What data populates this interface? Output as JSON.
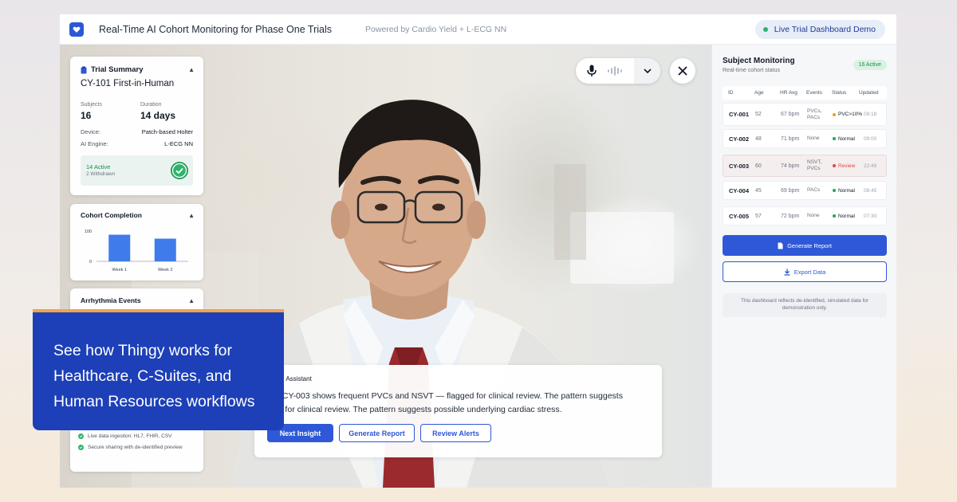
{
  "header": {
    "title": "Real-Time AI Cohort Monitoring for Phase One Trials",
    "powered_by": "Powered by Cardio Yield + L-ECG NN",
    "live_label": "Live Trial Dashboard Demo"
  },
  "trial_summary": {
    "heading": "Trial Summary",
    "trial_name": "CY-101 First-in-Human",
    "subjects_label": "Subjects",
    "subjects_value": "16",
    "duration_label": "Duration",
    "duration_value": "14 days",
    "device_label": "Device:",
    "device_value": "Patch-based Holter",
    "engine_label": "AI Engine:",
    "engine_value": "L-ECG NN",
    "active_text": "14 Active",
    "withdrawn_text": "2 Withdrawn"
  },
  "cohort_completion": {
    "heading": "Cohort Completion",
    "chart_data": {
      "type": "bar",
      "categories": [
        "Week 1",
        "Week 2"
      ],
      "values": [
        88,
        75
      ],
      "ylim": [
        0,
        100
      ],
      "ytick_labels": [
        "100",
        "0"
      ],
      "color": "#3f7bea"
    }
  },
  "arrhythmia_events": {
    "heading": "Arrhythmia Events"
  },
  "features": [
    "Live data ingestion: HL7, FHIR, CSV",
    "Secure sharing with de-identified preview"
  ],
  "promo": {
    "text": "See how Thingy works for\nHealthcare, C-Suites, and\nHuman Resources workflows"
  },
  "assistant": {
    "heading": "cal AI Assistant",
    "message": "ect CY-003 shows frequent PVCs and NSVT — flagged for clinical review. The pattern suggests\nged for clinical review. The pattern suggests possible underlying cardiac stress.",
    "buttons": [
      "Next Insight",
      "Generate Report",
      "Review Alerts"
    ]
  },
  "monitoring": {
    "title": "Subject Monitoring",
    "subtitle": "Real-time cohort status",
    "badge": "16 Active",
    "columns": [
      "ID",
      "Age",
      "HR Avg",
      "Events",
      "Status",
      "Updated"
    ],
    "rows": [
      {
        "id": "CY-001",
        "age": "52",
        "hr": "67 bpm",
        "events": "PVCs,\nPACs",
        "status": "PVC>10%",
        "status_color": "#f59e0b",
        "updated": "09:18"
      },
      {
        "id": "CY-002",
        "age": "48",
        "hr": "71 bpm",
        "events": "None",
        "status": "Normal",
        "status_color": "#22a55a",
        "updated": "09:00"
      },
      {
        "id": "CY-003",
        "age": "60",
        "hr": "74 bpm",
        "events": "NSVT,\nPVCs",
        "status": "Review",
        "status_color": "#e04444",
        "updated": "22:49"
      },
      {
        "id": "CY-004",
        "age": "45",
        "hr": "69 bpm",
        "events": "PACs",
        "status": "Normal",
        "status_color": "#22a55a",
        "updated": "08:45"
      },
      {
        "id": "CY-005",
        "age": "57",
        "hr": "72 bpm",
        "events": "None",
        "status": "Normal",
        "status_color": "#22a55a",
        "updated": "07:30"
      }
    ],
    "generate_label": "Generate Report",
    "export_label": "Export Data",
    "disclaimer": "This dashboard reflects de-identified, simulated data for demonstration only."
  }
}
